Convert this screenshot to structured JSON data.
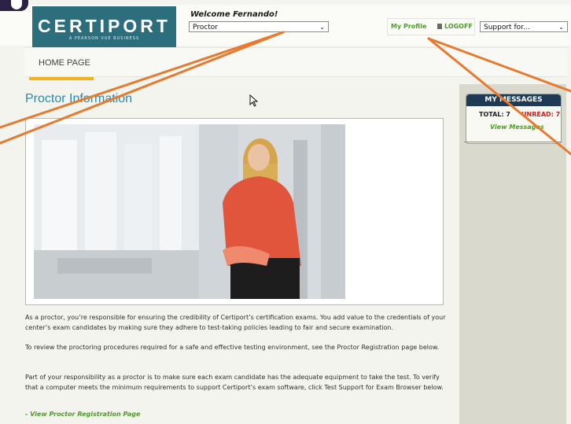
{
  "header": {
    "logo_text": "CERTIPORT",
    "logo_sub": "A PEARSON VUE BUSINESS",
    "welcome": "Welcome Fernando!",
    "role_select": "Proctor",
    "my_profile": "My Profile",
    "logoff": "LOGOFF",
    "support_select": "Support for..."
  },
  "nav": {
    "home": "HOME PAGE"
  },
  "main": {
    "title": "Proctor Information",
    "paragraphs": [
      "As a proctor, you’re responsible for ensuring the credibility of Certiport’s certification exams. You add value to the credentials of your center’s exam candidates by making sure they adhere to test-taking policies leading to fair and secure examination.",
      "To review the proctoring procedures required for a safe and effective testing environment, see the Proctor Registration page below.",
      "Part of your responsibility as a proctor is to make sure each exam candidate has the adequate equipment to take the test. To verify that a computer meets the minimum requirements to support Certiport’s exam software, click Test Support for Exam Browser below."
    ],
    "link": "- View Proctor Registration Page"
  },
  "messages": {
    "title": "MY MESSAGES",
    "total": "TOTAL: 7",
    "unread": "UNREAD: 7",
    "view": "View Messages"
  },
  "colors": {
    "accent_teal": "#2d6e7c",
    "link_green": "#4d9a28",
    "unread_red": "#cc1f1f",
    "annotation_orange": "#e77a2e"
  },
  "icons": {
    "lock": "lock-icon",
    "chevron": "chevron-down-icon",
    "cursor": "mouse-cursor-icon"
  }
}
